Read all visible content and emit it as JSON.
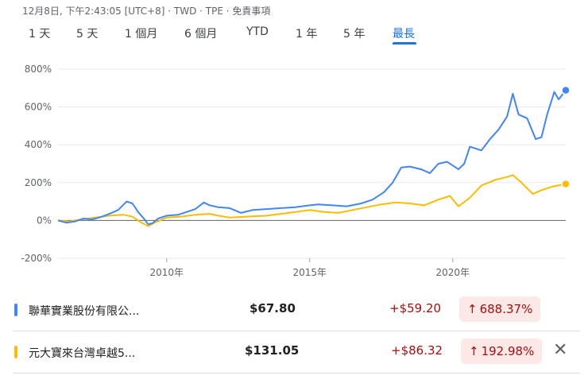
{
  "header": {
    "meta": "12月8日, 下午2:43:05 [UTC+8] · TWD · TPE · 免責事項"
  },
  "tabs": [
    {
      "label": "1 天",
      "active": false
    },
    {
      "label": "5 天",
      "active": false
    },
    {
      "label": "1 個月",
      "active": false
    },
    {
      "label": "6 個月",
      "active": false
    },
    {
      "label": "YTD",
      "active": false
    },
    {
      "label": "1 年",
      "active": false
    },
    {
      "label": "5 年",
      "active": false
    },
    {
      "label": "最長",
      "active": true
    }
  ],
  "colors": {
    "series1": "#4285f4",
    "series2": "#fbbc04",
    "active_tab": "#1a73e8",
    "loss_text": "#a50e0e",
    "badge_bg": "#fce8e6"
  },
  "chart_data": {
    "type": "line",
    "y_ticks": [
      "800%",
      "600%",
      "400%",
      "200%",
      "0%",
      "-200%"
    ],
    "y_tick_values": [
      800,
      600,
      400,
      200,
      0,
      -200
    ],
    "ylim": [
      -200,
      800
    ],
    "x_ticks": [
      {
        "label": "2010年",
        "value": 2010
      },
      {
        "label": "2015年",
        "value": 2015
      },
      {
        "label": "2020年",
        "value": 2020
      }
    ],
    "xlim": [
      2006.2,
      2023.95
    ],
    "grid": true,
    "series": [
      {
        "name": "聯華實業股份有限公...",
        "color": "#4285f4",
        "points": [
          [
            2006.2,
            0
          ],
          [
            2006.5,
            -12
          ],
          [
            2006.8,
            -5
          ],
          [
            2007.1,
            10
          ],
          [
            2007.4,
            5
          ],
          [
            2007.7,
            18
          ],
          [
            2008.0,
            35
          ],
          [
            2008.3,
            55
          ],
          [
            2008.6,
            100
          ],
          [
            2008.8,
            90
          ],
          [
            2009.0,
            45
          ],
          [
            2009.2,
            10
          ],
          [
            2009.35,
            -20
          ],
          [
            2009.5,
            -15
          ],
          [
            2009.7,
            10
          ],
          [
            2010.0,
            25
          ],
          [
            2010.4,
            30
          ],
          [
            2010.7,
            45
          ],
          [
            2011.0,
            60
          ],
          [
            2011.3,
            95
          ],
          [
            2011.5,
            80
          ],
          [
            2011.8,
            70
          ],
          [
            2012.2,
            65
          ],
          [
            2012.6,
            40
          ],
          [
            2013.0,
            55
          ],
          [
            2013.5,
            60
          ],
          [
            2014.0,
            65
          ],
          [
            2014.5,
            70
          ],
          [
            2015.0,
            80
          ],
          [
            2015.3,
            85
          ],
          [
            2015.8,
            80
          ],
          [
            2016.3,
            75
          ],
          [
            2016.8,
            90
          ],
          [
            2017.2,
            110
          ],
          [
            2017.6,
            150
          ],
          [
            2017.9,
            200
          ],
          [
            2018.2,
            280
          ],
          [
            2018.5,
            285
          ],
          [
            2018.9,
            270
          ],
          [
            2019.2,
            250
          ],
          [
            2019.5,
            300
          ],
          [
            2019.8,
            310
          ],
          [
            2020.2,
            270
          ],
          [
            2020.4,
            300
          ],
          [
            2020.6,
            390
          ],
          [
            2021.0,
            370
          ],
          [
            2021.3,
            430
          ],
          [
            2021.6,
            480
          ],
          [
            2021.9,
            550
          ],
          [
            2022.1,
            670
          ],
          [
            2022.3,
            560
          ],
          [
            2022.6,
            540
          ],
          [
            2022.9,
            430
          ],
          [
            2023.1,
            440
          ],
          [
            2023.3,
            560
          ],
          [
            2023.55,
            680
          ],
          [
            2023.7,
            640
          ],
          [
            2023.95,
            688
          ]
        ]
      },
      {
        "name": "元大寶來台灣卓越5...",
        "color": "#fbbc04",
        "points": [
          [
            2006.2,
            0
          ],
          [
            2006.6,
            -5
          ],
          [
            2007.0,
            5
          ],
          [
            2007.5,
            15
          ],
          [
            2008.0,
            25
          ],
          [
            2008.5,
            30
          ],
          [
            2008.8,
            20
          ],
          [
            2009.1,
            -10
          ],
          [
            2009.35,
            -30
          ],
          [
            2009.6,
            -10
          ],
          [
            2010.0,
            15
          ],
          [
            2010.5,
            20
          ],
          [
            2011.0,
            30
          ],
          [
            2011.5,
            35
          ],
          [
            2011.8,
            25
          ],
          [
            2012.2,
            15
          ],
          [
            2012.8,
            20
          ],
          [
            2013.5,
            25
          ],
          [
            2014.0,
            35
          ],
          [
            2014.5,
            45
          ],
          [
            2015.0,
            55
          ],
          [
            2015.5,
            45
          ],
          [
            2016.0,
            40
          ],
          [
            2016.5,
            55
          ],
          [
            2017.0,
            70
          ],
          [
            2017.5,
            85
          ],
          [
            2018.0,
            95
          ],
          [
            2018.5,
            90
          ],
          [
            2019.0,
            80
          ],
          [
            2019.5,
            110
          ],
          [
            2019.9,
            130
          ],
          [
            2020.2,
            75
          ],
          [
            2020.6,
            120
          ],
          [
            2021.0,
            185
          ],
          [
            2021.5,
            215
          ],
          [
            2021.9,
            230
          ],
          [
            2022.1,
            240
          ],
          [
            2022.4,
            200
          ],
          [
            2022.8,
            140
          ],
          [
            2023.1,
            160
          ],
          [
            2023.5,
            180
          ],
          [
            2023.95,
            193
          ]
        ]
      }
    ]
  },
  "watchlist": [
    {
      "name": "聯華實業股份有限公...",
      "price": "$67.80",
      "change": "+$59.20",
      "percent": "688.37%",
      "arrow": "↑",
      "marker_color": "#4285f4",
      "removable": false
    },
    {
      "name": "元大寶來台灣卓越5...",
      "price": "$131.05",
      "change": "+$86.32",
      "percent": "192.98%",
      "arrow": "↑",
      "marker_color": "#fbbc04",
      "removable": true,
      "remove_glyph": "✕"
    }
  ]
}
